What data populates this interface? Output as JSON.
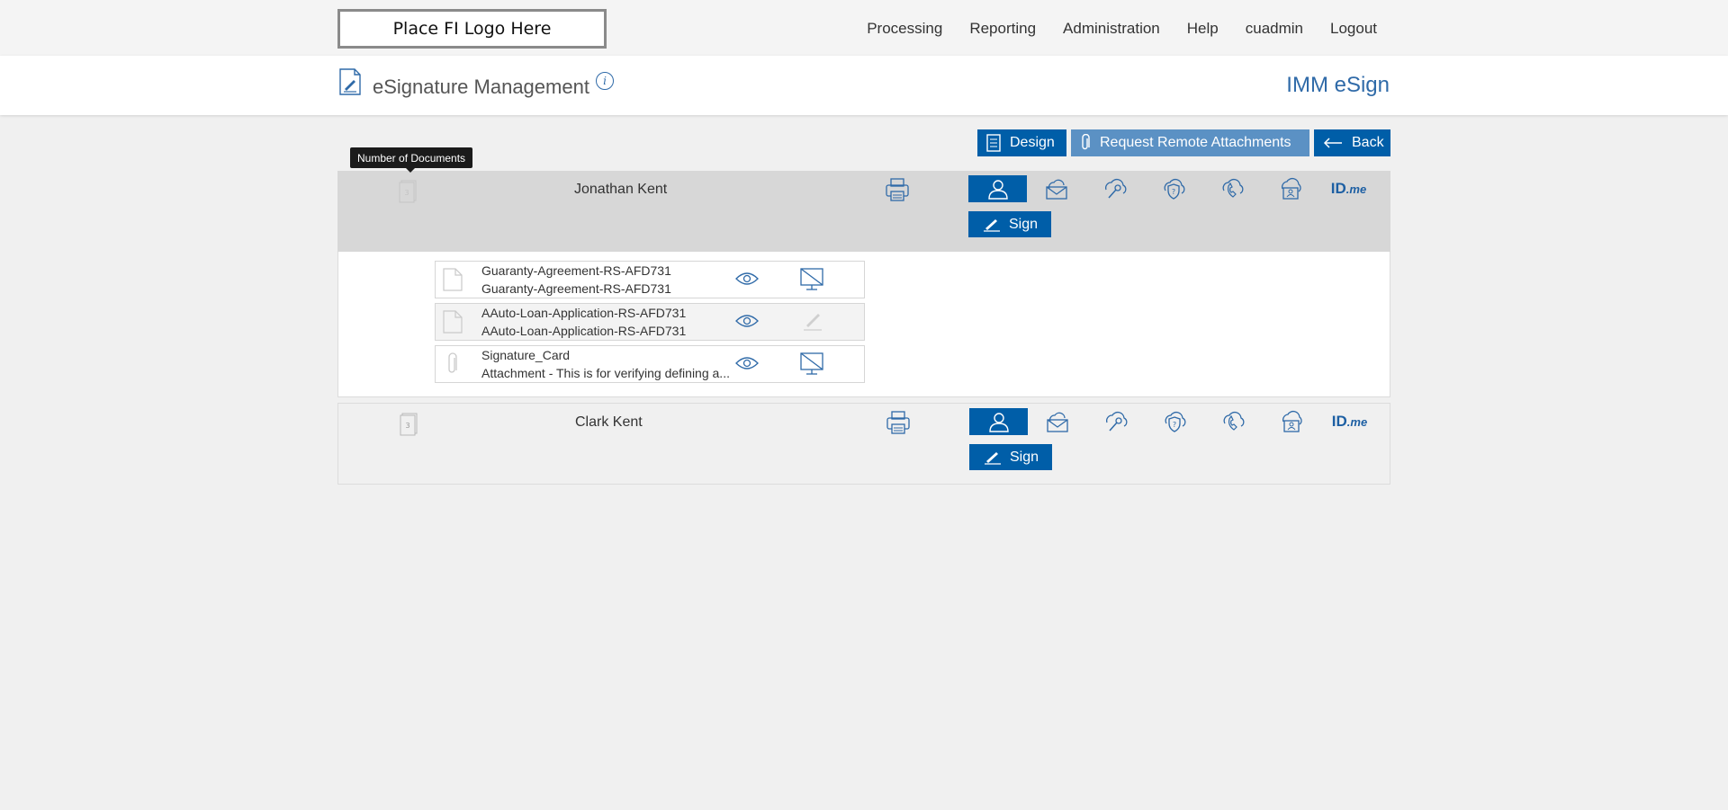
{
  "header": {
    "logo_text": "Place FI Logo Here",
    "nav": [
      "Processing",
      "Reporting",
      "Administration",
      "Help",
      "cuadmin",
      "Logout"
    ],
    "page_title": "eSignature Management",
    "info_icon": "info-icon",
    "brand": "IMM eSign"
  },
  "actions": {
    "design": "Design",
    "request_attachments": "Request Remote Attachments",
    "back": "Back"
  },
  "tooltip": "Number of Documents",
  "signers": [
    {
      "name": "Jonathan Kent",
      "doc_count": "3",
      "sign_label": "Sign",
      "auth_methods": [
        "in-person",
        "email",
        "key",
        "security-question",
        "phone",
        "id-verify",
        "idme"
      ],
      "selected_auth": "in-person",
      "idme_label": "ID",
      "idme_suffix": ".me"
    },
    {
      "name": "Clark Kent",
      "doc_count": "3",
      "sign_label": "Sign",
      "auth_methods": [
        "in-person",
        "email",
        "key",
        "security-question",
        "phone",
        "id-verify",
        "idme"
      ],
      "selected_auth": "in-person",
      "idme_label": "ID",
      "idme_suffix": ".me"
    }
  ],
  "documents": [
    {
      "line1": "Guaranty-Agreement-RS-AFD731",
      "line2": "Guaranty-Agreement-RS-AFD731",
      "type": "document",
      "status": "no-signature-required"
    },
    {
      "line1": "AAuto-Loan-Application-RS-AFD731",
      "line2": "AAuto-Loan-Application-RS-AFD731",
      "type": "document",
      "status": "signature"
    },
    {
      "line1": "Signature_Card",
      "line2": "Attachment - This is for verifying defining a...",
      "type": "attachment",
      "status": "no-signature-required"
    }
  ],
  "colors": {
    "primary": "#005ea8",
    "light_button": "#5b91c4",
    "brand": "#2f6aa8"
  }
}
